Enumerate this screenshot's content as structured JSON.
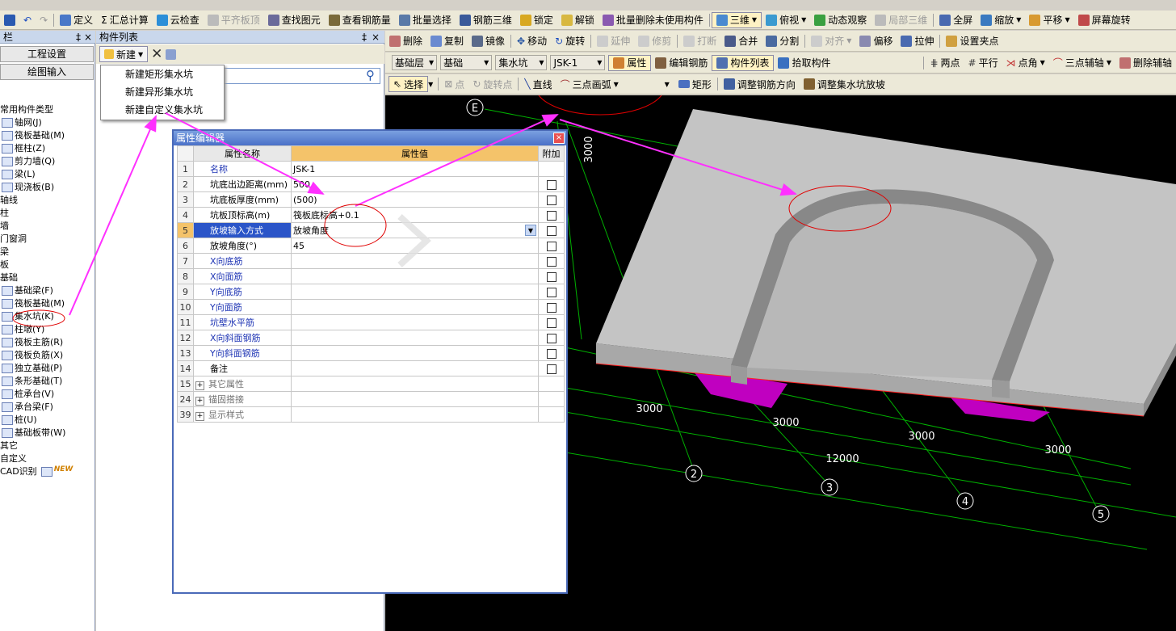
{
  "top_toolbar": {
    "items": [
      "定义",
      "汇总计算",
      "云检查",
      "平齐板顶",
      "查找图元",
      "查看钢筋量",
      "批量选择",
      "钢筋三维",
      "锁定",
      "解锁",
      "批量删除未使用构件",
      "三维",
      "俯视",
      "动态观察",
      "局部三维",
      "全屏",
      "缩放",
      "平移",
      "屏幕旋转"
    ]
  },
  "left_panel": {
    "title": "栏",
    "buttons": [
      "工程设置",
      "绘图输入"
    ],
    "tree": [
      "常用构件类型",
      "轴网(J)",
      "筏板基础(M)",
      "框柱(Z)",
      "剪力墙(Q)",
      "梁(L)",
      "现浇板(B)",
      "轴线",
      "柱",
      "墙",
      "门窗洞",
      "梁",
      "板",
      "基础",
      "基础梁(F)",
      "筏板基础(M)",
      "集水坑(K)",
      "柱墩(Y)",
      "筏板主筋(R)",
      "筏板负筋(X)",
      "独立基础(P)",
      "条形基础(T)",
      "桩承台(V)",
      "承台梁(F)",
      "桩(U)",
      "基础板带(W)",
      "其它",
      "自定义",
      "CAD识别"
    ],
    "new_badge": "NEW"
  },
  "component_list": {
    "title": "构件列表",
    "new_button": "新建",
    "menu": [
      "新建矩形集水坑",
      "新建异形集水坑",
      "新建自定义集水坑"
    ]
  },
  "toolbar2": {
    "items": [
      "删除",
      "复制",
      "镜像",
      "移动",
      "旋转",
      "延伸",
      "修剪",
      "打断",
      "合并",
      "分割",
      "对齐",
      "偏移",
      "拉伸",
      "设置夹点"
    ]
  },
  "toolbar3": {
    "dropdowns": [
      "基础层",
      "基础",
      "集水坑",
      "JSK-1"
    ],
    "items": [
      "属性",
      "编辑钢筋",
      "构件列表",
      "拾取构件",
      "两点",
      "平行",
      "点角",
      "三点辅轴",
      "删除辅轴"
    ]
  },
  "toolbar4": {
    "items": [
      "选择",
      "点",
      "旋转点",
      "直线",
      "三点画弧",
      "矩形",
      "调整钢筋方向",
      "调整集水坑放坡"
    ]
  },
  "property_editor": {
    "title": "属性编辑器",
    "headers": [
      "属性名称",
      "属性值",
      "附加"
    ],
    "rows": [
      {
        "num": "1",
        "name": "名称",
        "value": "JSK-1",
        "check": false
      },
      {
        "num": "2",
        "name": "坑底出边距离(mm)",
        "value": "500",
        "check": true
      },
      {
        "num": "3",
        "name": "坑底板厚度(mm)",
        "value": "(500)",
        "check": true
      },
      {
        "num": "4",
        "name": "坑板顶标高(m)",
        "value": "筏板底标高+0.1",
        "check": true
      },
      {
        "num": "5",
        "name": "放坡输入方式",
        "value": "放坡角度",
        "check": true
      },
      {
        "num": "6",
        "name": "放坡角度(°)",
        "value": "45",
        "check": true
      },
      {
        "num": "7",
        "name": "X向底筋",
        "value": "",
        "check": true
      },
      {
        "num": "8",
        "name": "X向面筋",
        "value": "",
        "check": true
      },
      {
        "num": "9",
        "name": "Y向底筋",
        "value": "",
        "check": true
      },
      {
        "num": "10",
        "name": "Y向面筋",
        "value": "",
        "check": true
      },
      {
        "num": "11",
        "name": "坑壁水平筋",
        "value": "",
        "check": true
      },
      {
        "num": "12",
        "name": "X向斜面钢筋",
        "value": "",
        "check": true
      },
      {
        "num": "13",
        "name": "Y向斜面钢筋",
        "value": "",
        "check": true
      },
      {
        "num": "14",
        "name": "备注",
        "value": "",
        "check": true
      },
      {
        "num": "15",
        "name": "其它属性",
        "value": "",
        "check": false
      },
      {
        "num": "24",
        "name": "锚固搭接",
        "value": "",
        "check": false
      },
      {
        "num": "39",
        "name": "显示样式",
        "value": "",
        "check": false
      }
    ]
  },
  "canvas": {
    "axis_labels": [
      "E",
      "2",
      "3",
      "4",
      "5"
    ],
    "dimensions": [
      "3000",
      "3000",
      "3000",
      "3000",
      "3000",
      "12000"
    ],
    "colors": {
      "bg": "#000000",
      "slab": "#c0c0c0",
      "pit": "#c000c0",
      "grid": "#00c000",
      "annotation": "#ff30ff",
      "circle": "#e00000"
    }
  }
}
